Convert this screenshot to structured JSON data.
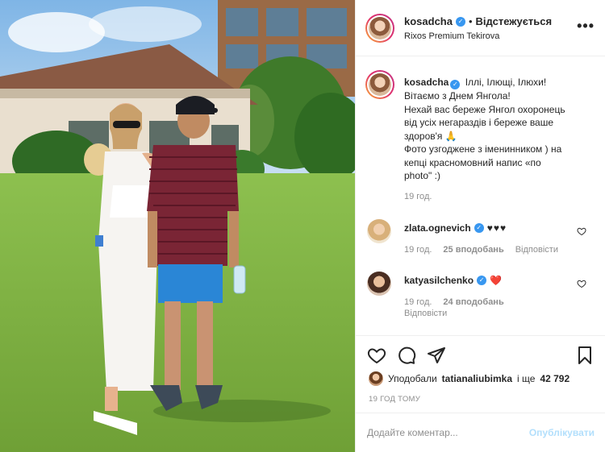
{
  "post": {
    "username": "kosadcha",
    "separator": "•",
    "follow_status": "Відстежується",
    "location": "Rixos Premium Tekirova",
    "more_icon": "more-horizontal-icon"
  },
  "caption": {
    "username": "kosadcha",
    "lines": [
      "Іллі, Ілющі, Ілюхи!",
      "Вітаємо з Днем Янгола!",
      "Нехай вас береже Янгол охоронець",
      "від усіх негараздів і береже ваше",
      "здоров'я 🙏",
      "Фото узгоджене з іменинником ) на",
      "кепці красномовний напис «по",
      "photo\" :)"
    ],
    "time": "19 год."
  },
  "comments": [
    {
      "username": "zlata.ognevich",
      "text": "♥♥♥",
      "time": "19 год.",
      "likes": "25 вподобань",
      "reply": "Відповісти"
    },
    {
      "username": "katyasilchenko",
      "text": "❤️",
      "time": "19 год.",
      "likes": "24 вподобань",
      "reply": "Відповісти"
    }
  ],
  "actions": {
    "like_icon": "heart-icon",
    "comment_icon": "comment-icon",
    "share_icon": "share-icon",
    "save_icon": "bookmark-icon"
  },
  "likes_line": {
    "prefix": "Уподобали",
    "user": "tatianaliubimka",
    "suffix": "і ще",
    "count": "42 792"
  },
  "posted_ago": "19 ГОД ТОМУ",
  "comment_box": {
    "placeholder": "Додайте коментар...",
    "publish_label": "Опублікувати"
  },
  "colors": {
    "accent_blue": "#3897f0",
    "publish_disabled": "#b2dffc",
    "heart_red": "#ed4956",
    "muted": "#8e8e8e",
    "text": "#262626"
  }
}
